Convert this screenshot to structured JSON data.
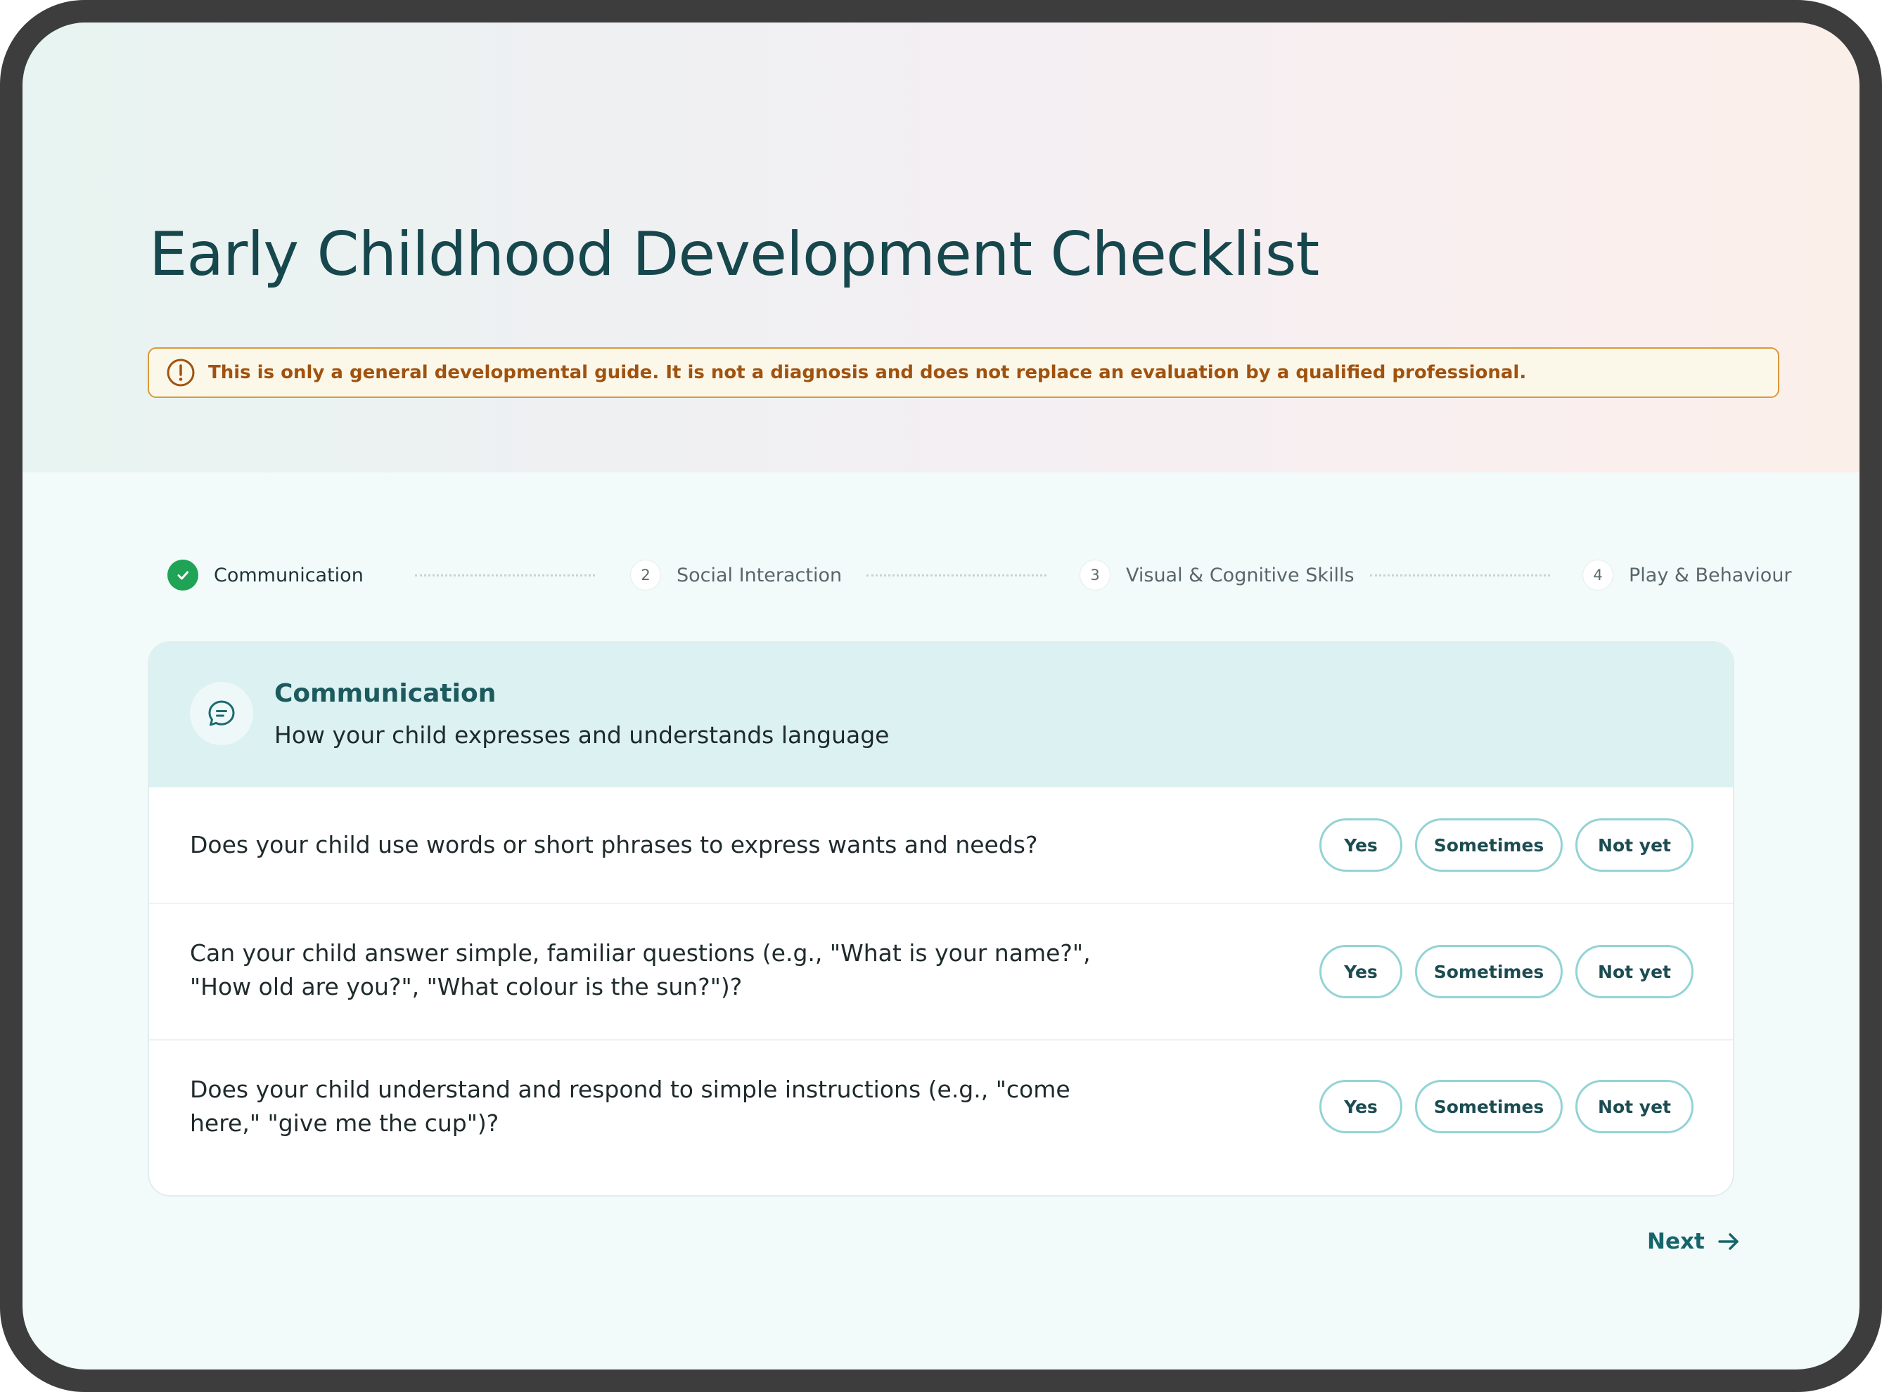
{
  "page": {
    "title": "Early Childhood Development Checklist",
    "disclaimer": "This is only a general developmental guide. It is not a diagnosis and does not replace an evaluation by a qualified professional."
  },
  "stepper": {
    "steps": [
      {
        "number": "1",
        "label": "Communication",
        "status": "completed"
      },
      {
        "number": "2",
        "label": "Social Interaction",
        "status": "upcoming"
      },
      {
        "number": "3",
        "label": "Visual & Cognitive Skills",
        "status": "upcoming"
      },
      {
        "number": "4",
        "label": "Play & Behaviour",
        "status": "upcoming"
      }
    ]
  },
  "section": {
    "icon": "chat-bubble-icon",
    "title": "Communication",
    "subtitle": "How your child expresses and understands language",
    "questions": [
      {
        "text": "Does your child use words or short phrases to express wants and needs?"
      },
      {
        "text": "Can your child answer simple, familiar questions (e.g., \"What is your name?\", \"How old are you?\", \"What colour is the sun?\")?"
      },
      {
        "text": "Does your child understand and respond to simple instructions (e.g., \"come here,\" \"give me the cup\")?"
      }
    ],
    "options": {
      "yes": "Yes",
      "sometimes": "Sometimes",
      "not_yet": "Not yet"
    }
  },
  "navigation": {
    "next_label": "Next"
  },
  "colors": {
    "title": "#16474d",
    "accent": "#16656a",
    "success": "#1fa354",
    "warning_border": "#d9993a",
    "warning_text": "#a0520f",
    "option_border": "#93d3d6",
    "header_bg": "#dbf1f2"
  }
}
